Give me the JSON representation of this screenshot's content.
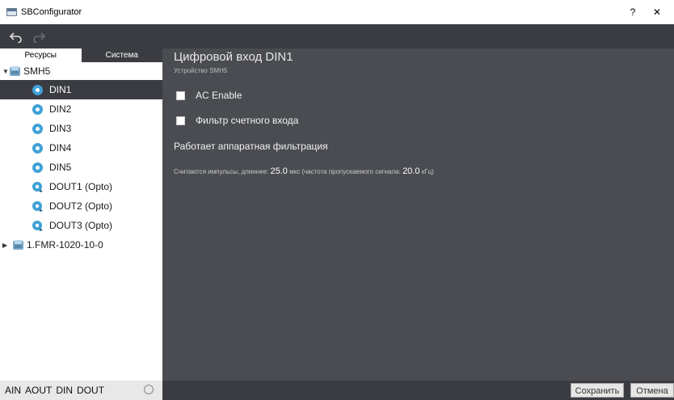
{
  "window": {
    "title": "SBConfigurator",
    "help_label": "?",
    "close_label": "✕"
  },
  "toolbar": {
    "undo_icon": "undo-icon",
    "redo_icon": "redo-icon"
  },
  "sidebar": {
    "tabs": [
      {
        "label": "Ресурсы",
        "active": true
      },
      {
        "label": "Система",
        "active": false
      }
    ],
    "tree": {
      "root": {
        "label": "SMH5",
        "expanded": true
      },
      "children": [
        {
          "label": "DIN1",
          "selected": true
        },
        {
          "label": "DIN2"
        },
        {
          "label": "DIN3"
        },
        {
          "label": "DIN4"
        },
        {
          "label": "DIN5"
        },
        {
          "label": "DOUT1 (Opto)"
        },
        {
          "label": "DOUT2 (Opto)"
        },
        {
          "label": "DOUT3 (Opto)"
        }
      ],
      "second_root": {
        "label": "1.FMR-1020-10-0",
        "expanded": false
      }
    }
  },
  "main": {
    "title": "Цифровой вход DIN1",
    "subtitle": "Устройство SMH5",
    "ac_enable": {
      "label": "AC Enable",
      "checked": false
    },
    "counter_filter": {
      "label": "Фильтр счетного входа",
      "checked": false
    },
    "status": "Работает аппаратная фильтрация",
    "info": {
      "prefix": "Считаются импульсы, длиннее:",
      "duration_value": "25.0",
      "duration_unit": "мкс",
      "freq_prefix": "(частота пропускаемого сигнала:",
      "freq_value": "20.0",
      "freq_unit": "кГц)"
    }
  },
  "bottom": {
    "filters": [
      "AIN",
      "AOUT",
      "DIN",
      "DOUT"
    ],
    "save_label": "Сохранить",
    "cancel_label": "Отмена"
  },
  "colors": {
    "dark_bar": "#3a3c41",
    "panel": "#4a4c51",
    "icon_blue": "#3fa1d6"
  }
}
